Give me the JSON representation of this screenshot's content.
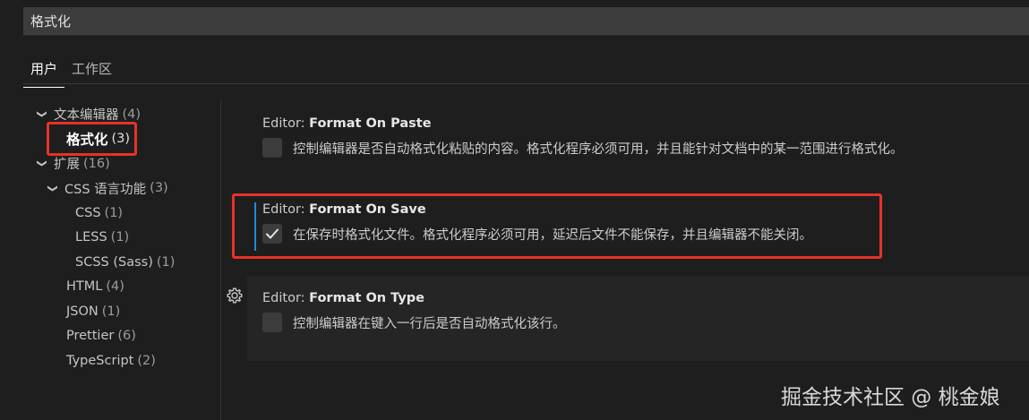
{
  "search": {
    "value": "格式化"
  },
  "tabs": [
    {
      "label": "用户",
      "active": true
    },
    {
      "label": "工作区",
      "active": false
    }
  ],
  "toc": {
    "items": [
      {
        "label": "文本编辑器",
        "count": "(4)",
        "expanded": true
      },
      {
        "label": "格式化",
        "count": "(3)",
        "selected": true
      },
      {
        "label": "扩展",
        "count": "(16)",
        "expanded": true
      },
      {
        "label": "CSS 语言功能",
        "count": "(3)",
        "expanded": true
      },
      {
        "label": "CSS",
        "count": "(1)"
      },
      {
        "label": "LESS",
        "count": "(1)"
      },
      {
        "label": "SCSS (Sass)",
        "count": "(1)"
      },
      {
        "label": "HTML",
        "count": "(4)"
      },
      {
        "label": "JSON",
        "count": "(1)"
      },
      {
        "label": "Prettier",
        "count": "(6)"
      },
      {
        "label": "TypeScript",
        "count": "(2)"
      }
    ]
  },
  "settings": [
    {
      "category": "Editor: ",
      "key": "Format On Paste",
      "description": "控制编辑器是否自动格式化粘贴的内容。格式化程序必须可用，并且能针对文档中的某一范围进行格式化。",
      "checked": false
    },
    {
      "category": "Editor: ",
      "key": "Format On Save",
      "description": "在保存时格式化文件。格式化程序必须可用，延迟后文件不能保存，并且编辑器不能关闭。",
      "checked": true
    },
    {
      "category": "Editor: ",
      "key": "Format On Type",
      "description": "控制编辑器在键入一行后是否自动格式化该行。",
      "checked": false
    }
  ],
  "watermark": "掘金技术社区 @ 桃金娘",
  "colors": {
    "annotation_red": "#e5322b",
    "focus_accent": "#1d8bd6",
    "background": "#1e1e1e"
  }
}
